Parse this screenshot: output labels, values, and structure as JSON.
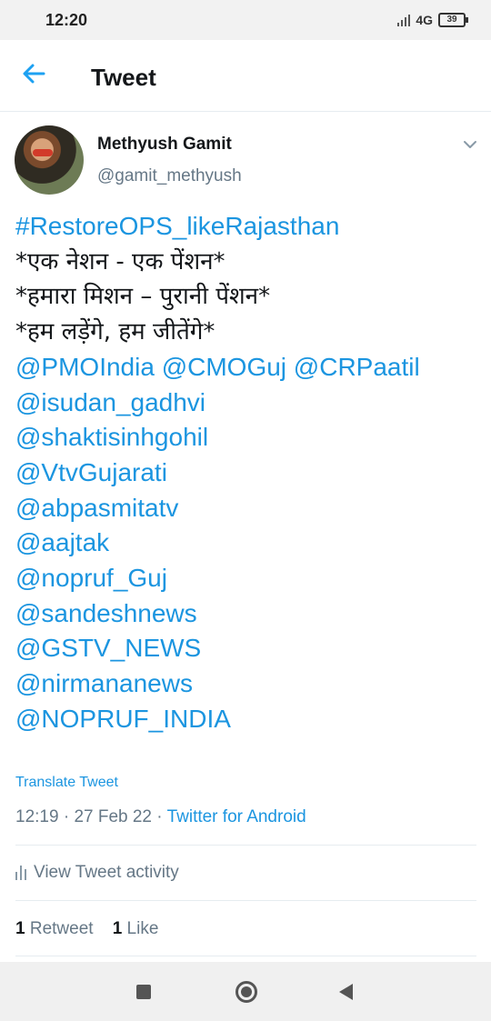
{
  "status_bar": {
    "time": "12:20",
    "network": "4G",
    "battery": "39"
  },
  "header": {
    "title": "Tweet"
  },
  "tweet": {
    "author_name": "Methyush Gamit",
    "author_handle": "@gamit_methyush",
    "lines": [
      "#RestoreOPS_likeRajasthan",
      "*एक नेशन - एक पेंशन*",
      "*हमारा मिशन – पुरानी पेंशन*",
      "*हम लड़ेंगे, हम जीतेंगे*",
      "@PMOIndia @CMOGuj  @CRPaatil",
      "@isudan_gadhvi",
      "@shaktisinhgohil",
      "@VtvGujarati",
      "@abpasmitatv",
      "@aajtak",
      "@nopruf_Guj",
      "@sandeshnews",
      "@GSTV_NEWS",
      "@nirmananews",
      "@NOPRUF_INDIA"
    ],
    "translate_label": "Translate Tweet",
    "time": "12:19",
    "date": "27 Feb 22",
    "source": "Twitter for Android",
    "activity_label": "View Tweet activity",
    "retweet_count": "1",
    "retweet_label": "Retweet",
    "like_count": "1",
    "like_label": "Like"
  },
  "colors": {
    "accent": "#1b95e0",
    "text": "#14171a",
    "secondary": "#657786"
  }
}
